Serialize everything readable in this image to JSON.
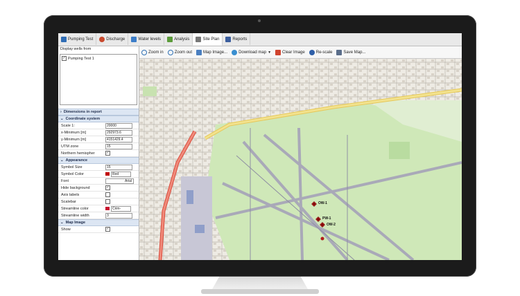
{
  "tabs": [
    {
      "label": "Pumping Test",
      "icon": "pumping-test-icon",
      "color": "#2f6db5"
    },
    {
      "label": "Discharge",
      "icon": "discharge-icon",
      "color": "#c94a2e"
    },
    {
      "label": "Water levels",
      "icon": "water-levels-icon",
      "color": "#3d7ec9"
    },
    {
      "label": "Analysis",
      "icon": "analysis-icon",
      "color": "#5b9b3a"
    },
    {
      "label": "Site Plan",
      "icon": "site-plan-icon",
      "color": "#777777"
    },
    {
      "label": "Reports",
      "icon": "reports-icon",
      "color": "#3b5e9e"
    }
  ],
  "left": {
    "display_wells_label": "Display wells from",
    "well_item": "Pumping Test 1",
    "sections": {
      "dimensions": "Dimensions in report",
      "coordinate": "Coordinate system",
      "appearance": "Appearance",
      "map_image": "Map Image"
    },
    "props": {
      "scale_label": "Scale 1:",
      "scale_value": "20000",
      "xmin_label": "x-Minimum [m]",
      "xmin_value": "292973.6",
      "ymin_label": "y-Minimum [m]",
      "ymin_value": "4151429.4",
      "utm_label": "UTM zone",
      "utm_value": "15",
      "north_label": "Northern hemispher",
      "symsize_label": "Symbol Size",
      "symsize_value": "15",
      "symcolor_label": "Symbol Color",
      "symcolor_value": "Red",
      "font_label": "Font",
      "font_value": "Arial",
      "hidebg_label": "Hide background",
      "axis_label": "Axis labels",
      "scalebar_label": "Scalebar",
      "stream_color_label": "Streamline color",
      "stream_color_value": "Crim-",
      "stream_width_label": "Streamline width",
      "stream_width_value": "3",
      "show_label": "Show"
    }
  },
  "toolbar": [
    {
      "label": "Zoom in",
      "icon": "zoom-in-icon"
    },
    {
      "label": "Zoom out",
      "icon": "zoom-out-icon"
    },
    {
      "label": "Map Image...",
      "icon": "map-image-icon"
    },
    {
      "label": "Download map",
      "icon": "download-map-icon"
    },
    {
      "label": "Clear Image",
      "icon": "clear-image-icon"
    },
    {
      "label": "Re-scale",
      "icon": "rescale-icon"
    },
    {
      "label": "Save Map...",
      "icon": "save-map-icon"
    }
  ],
  "map": {
    "wells": [
      {
        "label": "OW-1"
      },
      {
        "label": "PW-1"
      },
      {
        "label": "OW-2"
      }
    ]
  },
  "colors": {
    "accent": "#dce6f3",
    "well": "#b11b1b",
    "runway": "#a9a9b8",
    "grass": "#cfe8b8",
    "road": "#e86a5a"
  }
}
